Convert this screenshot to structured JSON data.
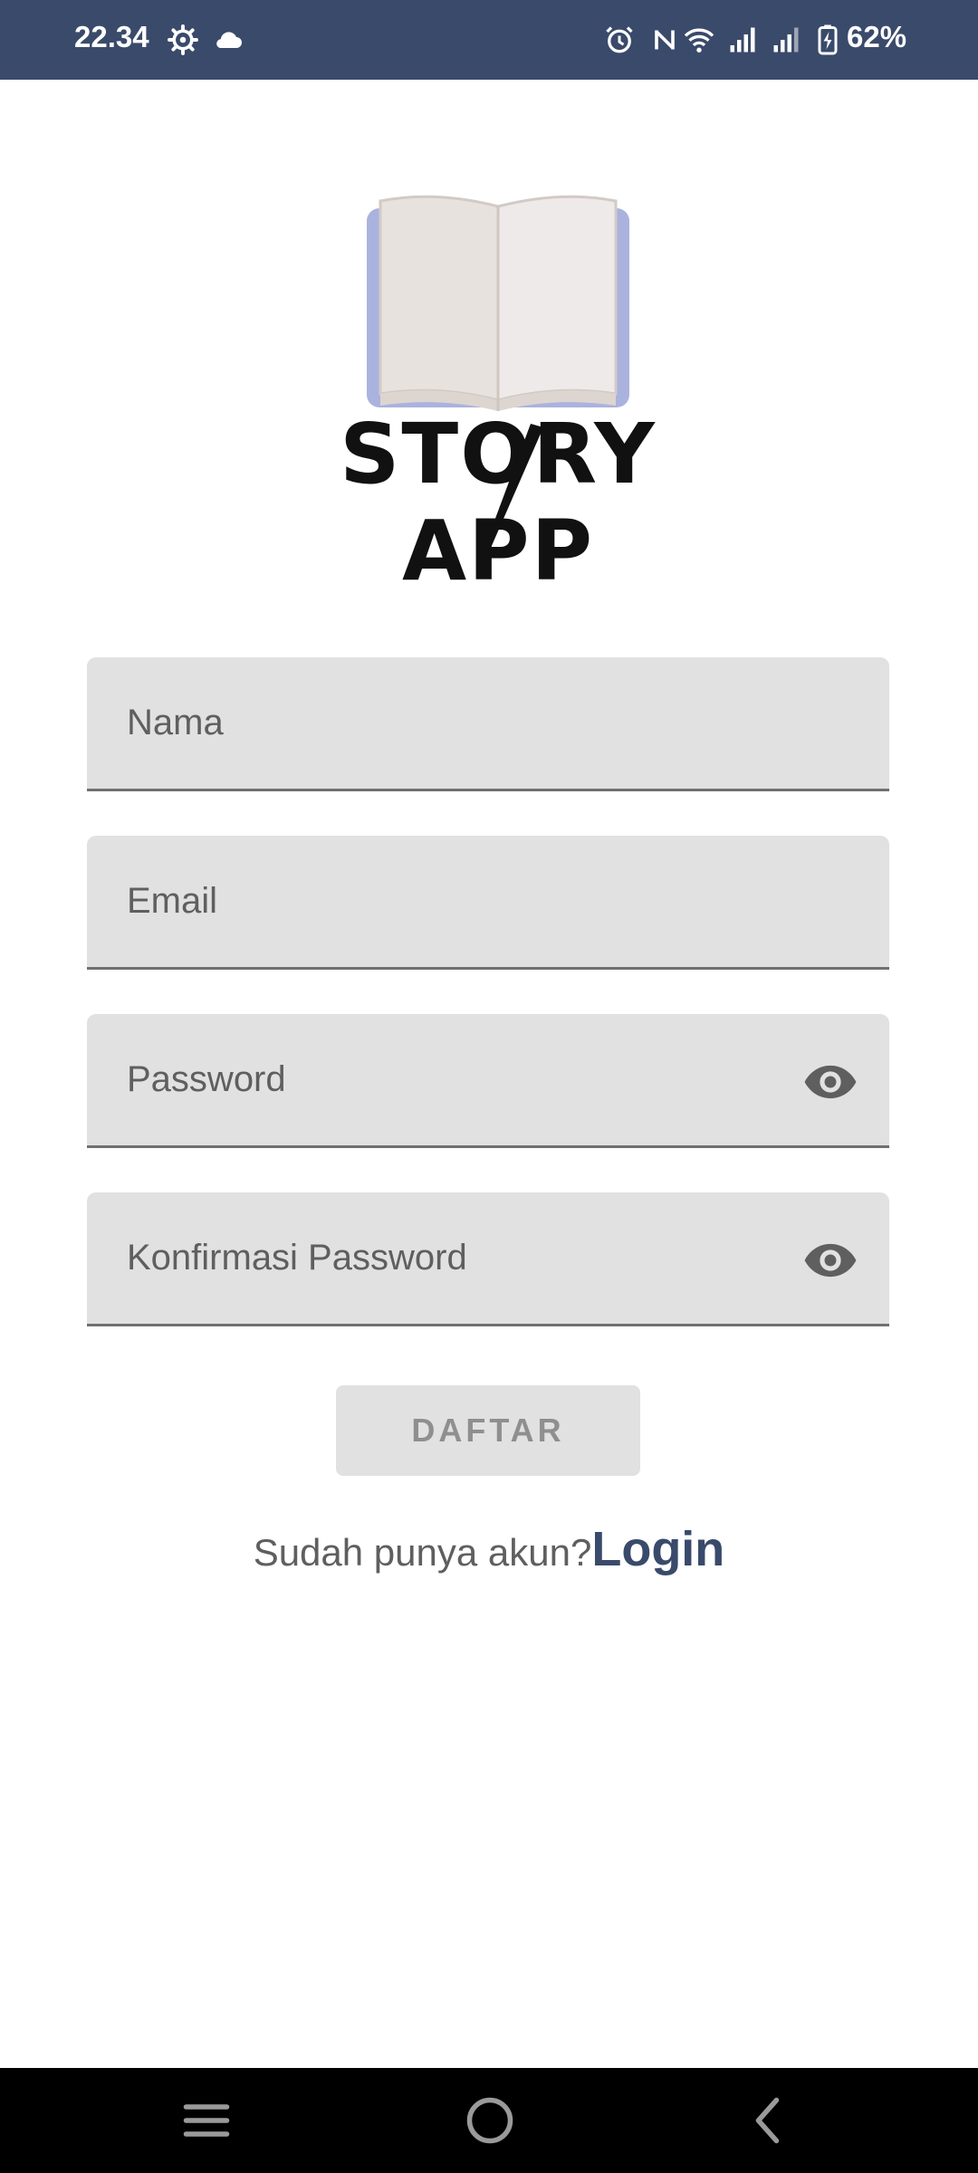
{
  "status_bar": {
    "time": "22.34",
    "battery_percent": "62%",
    "icons": [
      "settings-gear-icon",
      "cloud-icon",
      "alarm-icon",
      "nfc-icon",
      "wifi-icon",
      "signal-icon",
      "signal-icon",
      "battery-charging-icon"
    ]
  },
  "logo": {
    "text": "STORY APP",
    "icon": "open-book-icon"
  },
  "form": {
    "name_placeholder": "Nama",
    "email_placeholder": "Email",
    "password_placeholder": "Password",
    "confirm_password_placeholder": "Konfirmasi Password",
    "visibility_icon": "eye-icon",
    "submit_label": "DAFTAR"
  },
  "login_prompt": {
    "text": "Sudah punya akun?",
    "link_label": "Login"
  },
  "nav_bar": {
    "icons": [
      "recents-icon",
      "home-icon",
      "back-icon"
    ]
  },
  "colors": {
    "accent": "#3a4a6b",
    "field_background": "#e1e1e1",
    "nav_background": "#000000"
  }
}
